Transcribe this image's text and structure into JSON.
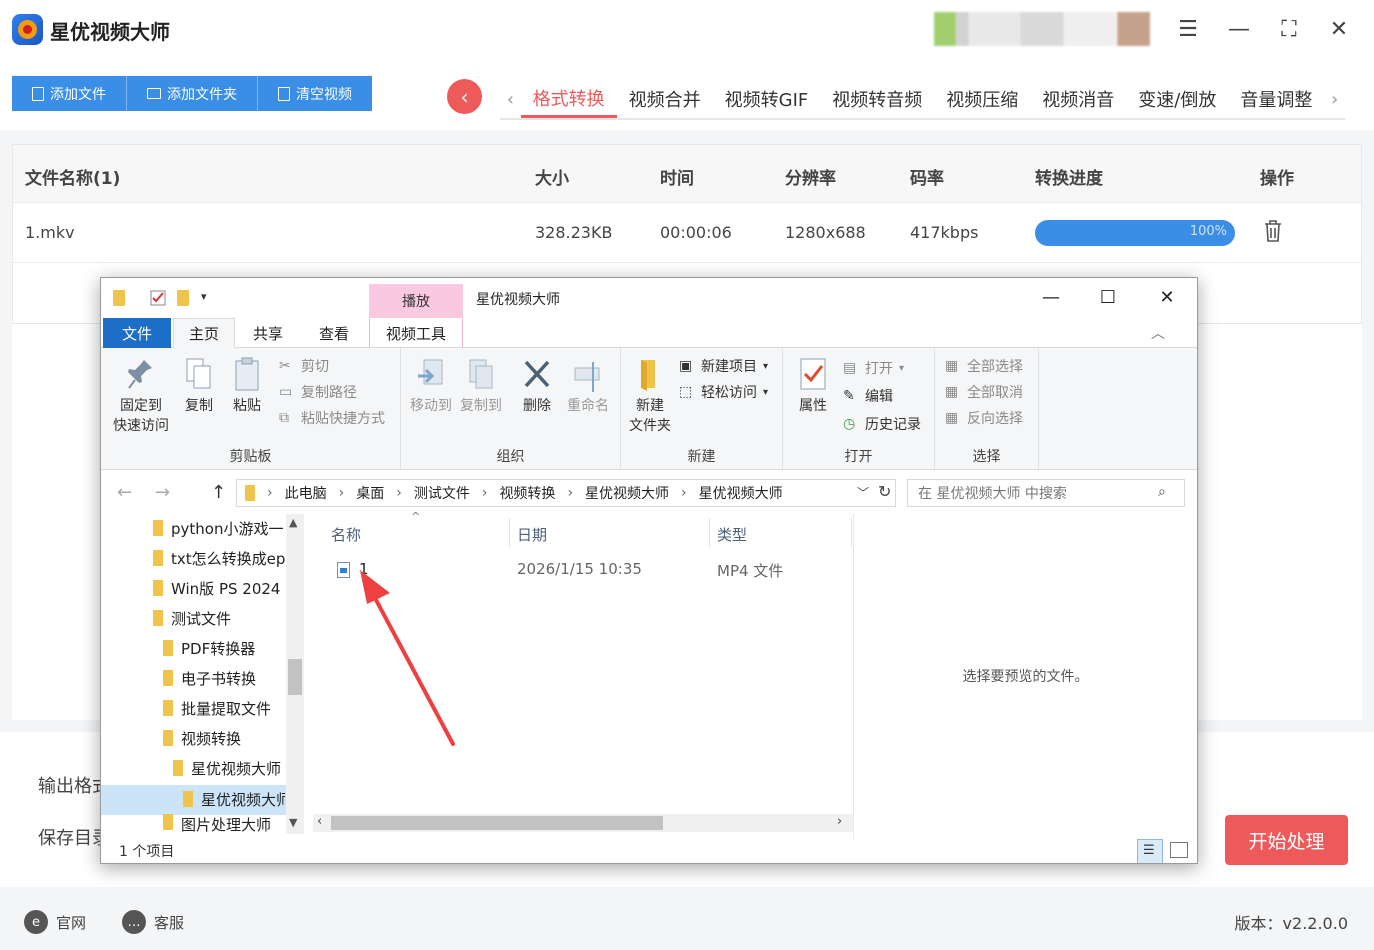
{
  "app": {
    "title": "星优视频大师",
    "toolbar": [
      "添加文件",
      "添加文件夹",
      "清空视频"
    ],
    "tabs": [
      "格式转换",
      "视频合并",
      "视频转GIF",
      "视频转音频",
      "视频压缩",
      "视频消音",
      "变速/倒放",
      "音量调整"
    ],
    "active_tab": "格式转换",
    "table": {
      "headers": [
        "文件名称(1)",
        "大小",
        "时间",
        "分辨率",
        "码率",
        "转换进度",
        "操作"
      ],
      "rows": [
        {
          "name": "1.mkv",
          "size": "328.23KB",
          "time": "00:00:06",
          "resolution": "1280x688",
          "bitrate": "417kbps",
          "progress_label": "100%",
          "progress": 1.0
        }
      ]
    },
    "output_format_label": "输出格式",
    "save_dir_label": "保存目录",
    "start_button": "开始处理",
    "footer": {
      "site": "官网",
      "support": "客服",
      "version": "版本：v2.2.0.0"
    },
    "accent_color": "#3a8ee6",
    "danger_color": "#ee5a5a"
  },
  "explorer": {
    "window_title": "星优视频大师",
    "context_tab": "播放",
    "ribbon_tabs": [
      "文件",
      "主页",
      "共享",
      "查看",
      "视频工具"
    ],
    "ribbon": {
      "clipboard": {
        "label": "剪贴板",
        "pin": "固定到\n快速访问",
        "copy": "复制",
        "paste": "粘贴",
        "cut": "剪切",
        "copy_path": "复制路径",
        "paste_shortcut": "粘贴快捷方式"
      },
      "organize": {
        "label": "组织",
        "move_to": "移动到",
        "copy_to": "复制到",
        "delete": "删除",
        "rename": "重命名"
      },
      "new": {
        "label": "新建",
        "new_folder": "新建\n文件夹",
        "new_item": "新建项目",
        "easy_access": "轻松访问"
      },
      "open": {
        "label": "打开",
        "properties": "属性",
        "open": "打开",
        "edit": "编辑",
        "history": "历史记录"
      },
      "select": {
        "label": "选择",
        "select_all": "全部选择",
        "select_none": "全部取消",
        "invert": "反向选择"
      }
    },
    "breadcrumb": [
      "此电脑",
      "桌面",
      "测试文件",
      "视频转换",
      "星优视频大师",
      "星优视频大师"
    ],
    "search_placeholder": "在 星优视频大师 中搜索",
    "nav_items": [
      {
        "label": "python小游戏一",
        "indent": 0
      },
      {
        "label": "txt怎么转换成ep",
        "indent": 0
      },
      {
        "label": "Win版 PS 2024",
        "indent": 0
      },
      {
        "label": "测试文件",
        "indent": 0
      },
      {
        "label": "PDF转换器",
        "indent": 1
      },
      {
        "label": "电子书转换",
        "indent": 1
      },
      {
        "label": "批量提取文件",
        "indent": 1
      },
      {
        "label": "视频转换",
        "indent": 1
      },
      {
        "label": "星优视频大师",
        "indent": 2
      },
      {
        "label": "星优视频大师",
        "indent": 3
      },
      {
        "label": "图片处理大师",
        "indent": 1
      }
    ],
    "columns": [
      "名称",
      "日期",
      "类型"
    ],
    "files": [
      {
        "name": "1",
        "date": "2026/1/15 10:35",
        "type": "MP4 文件"
      }
    ],
    "preview_text": "选择要预览的文件。",
    "status": "1 个项目"
  }
}
